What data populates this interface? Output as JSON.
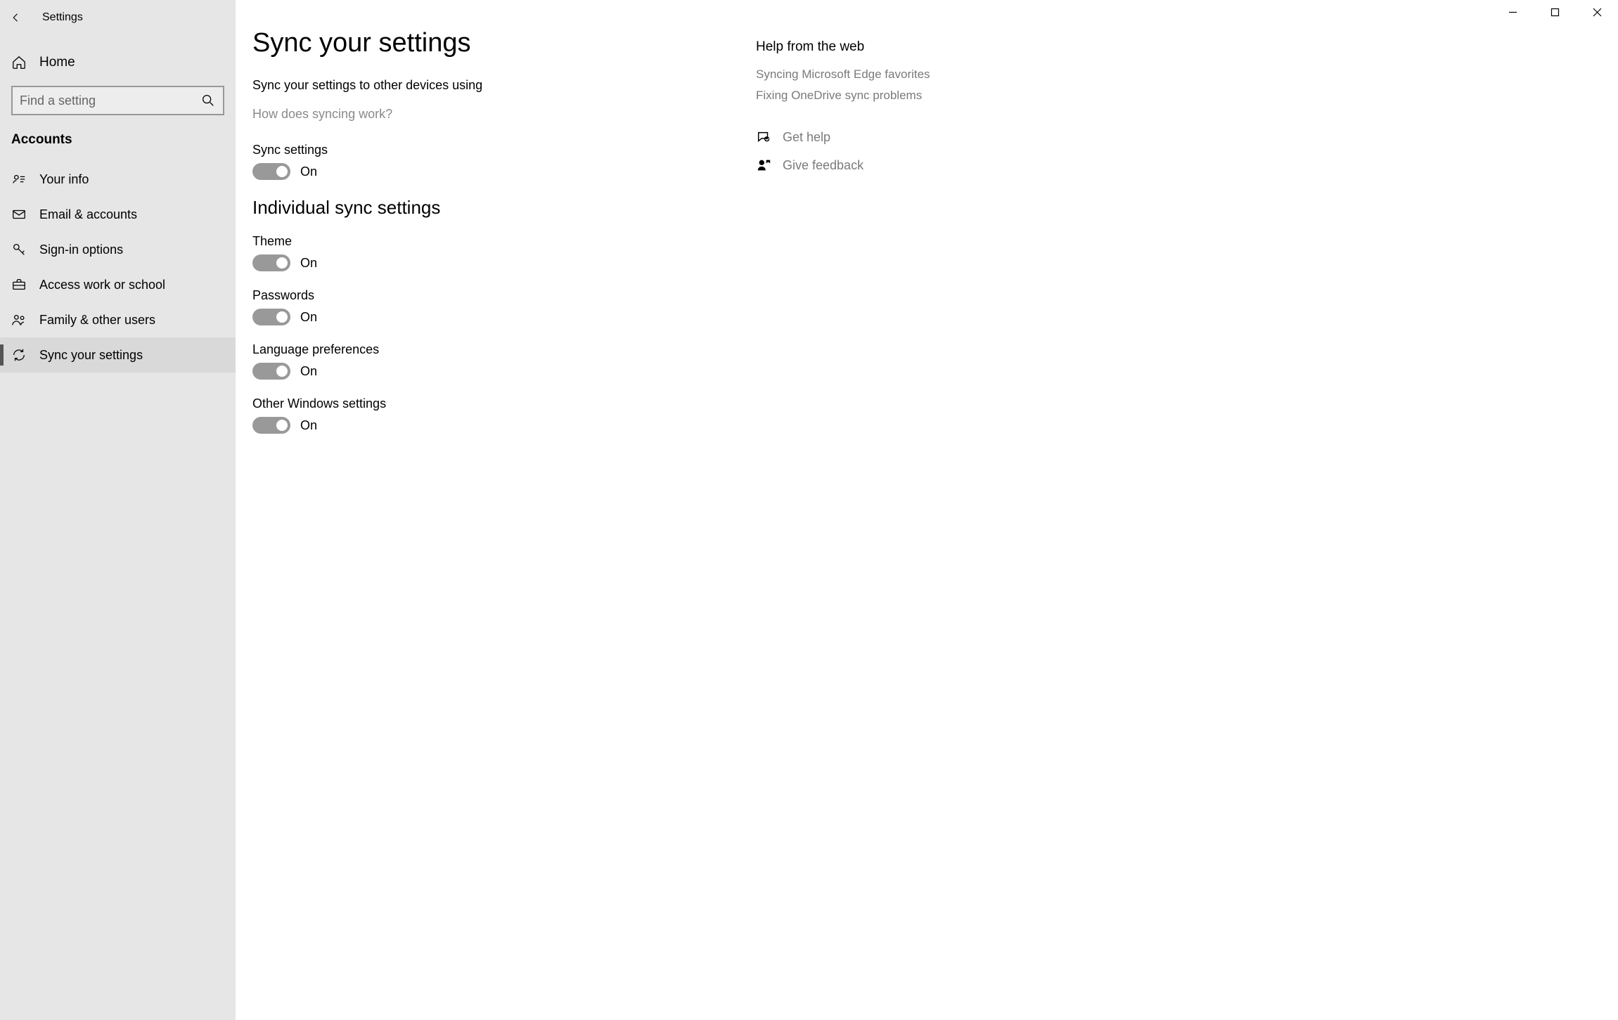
{
  "window": {
    "title": "Settings"
  },
  "sidebar": {
    "home_label": "Home",
    "search_placeholder": "Find a setting",
    "category_label": "Accounts",
    "items": [
      {
        "label": "Your info"
      },
      {
        "label": "Email & accounts"
      },
      {
        "label": "Sign-in options"
      },
      {
        "label": "Access work or school"
      },
      {
        "label": "Family & other users"
      },
      {
        "label": "Sync your settings"
      }
    ]
  },
  "main": {
    "title": "Sync your settings",
    "lead": "Sync your settings to other devices using",
    "how_link": "How does syncing work?",
    "sync_settings_label": "Sync settings",
    "sync_settings_state": "On",
    "individual_heading": "Individual sync settings",
    "settings": [
      {
        "label": "Theme",
        "state": "On"
      },
      {
        "label": "Passwords",
        "state": "On"
      },
      {
        "label": "Language preferences",
        "state": "On"
      },
      {
        "label": "Other Windows settings",
        "state": "On"
      }
    ]
  },
  "help": {
    "title": "Help from the web",
    "links": [
      "Syncing Microsoft Edge favorites",
      "Fixing OneDrive sync problems"
    ],
    "get_help_label": "Get help",
    "feedback_label": "Give feedback"
  }
}
